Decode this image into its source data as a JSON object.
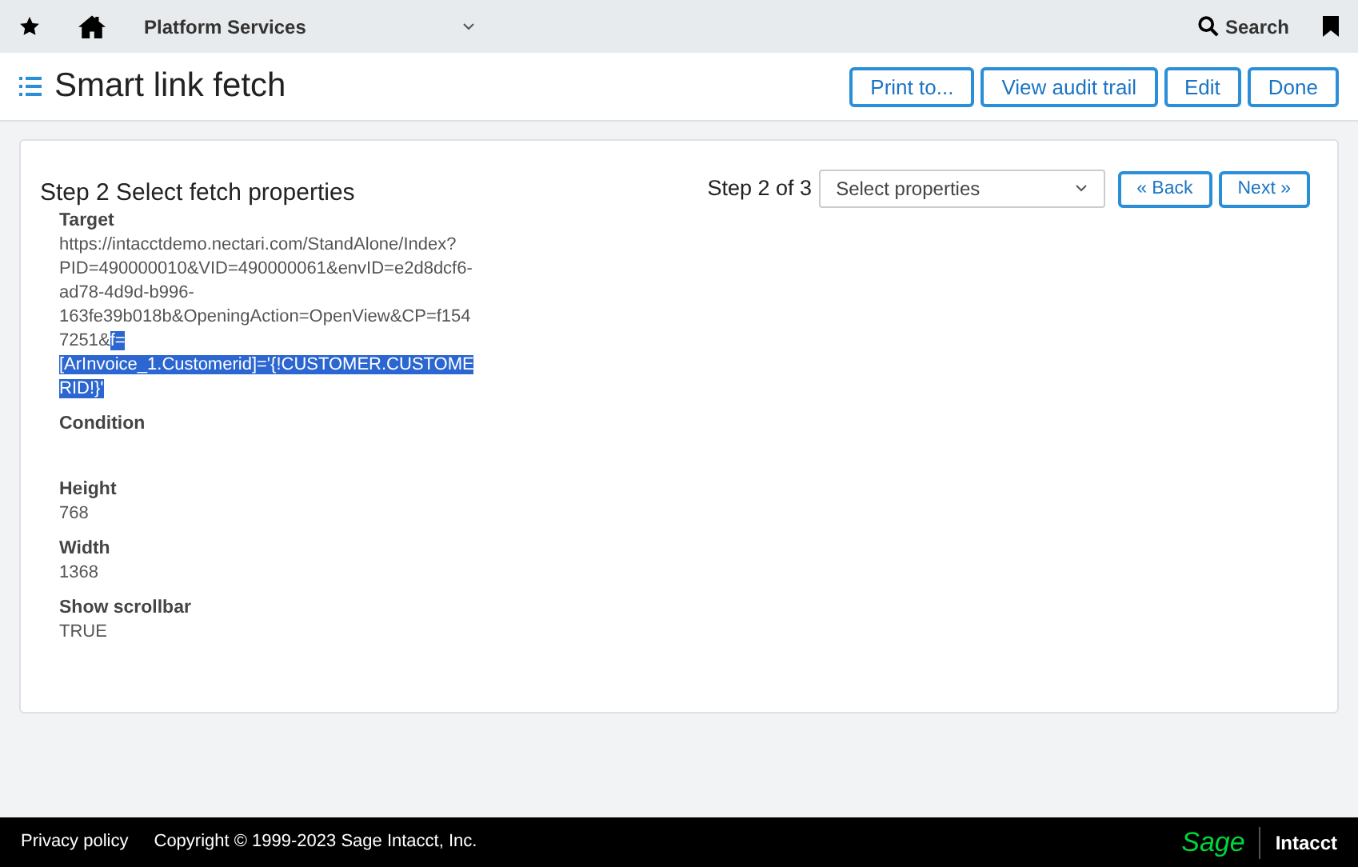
{
  "top_bar": {
    "module": "Platform Services",
    "search": "Search"
  },
  "header": {
    "title": "Smart link fetch",
    "buttons": [
      "Print to...",
      "View audit trail",
      "Edit",
      "Done"
    ]
  },
  "wizard": {
    "heading": "Step 2 Select fetch properties",
    "step": "Step 2 of 3",
    "select": {
      "value": "Select properties"
    },
    "back": "« Back",
    "next": "Next »"
  },
  "fields": [
    {
      "label": "Target",
      "value_parts": [
        {
          "text": "https://intacctdemo.nectari.com/StandAlone/Index?PID=490000010&VID=490000061&envID=e2d8dcf6-ad78-4d9d-b996-163fe39b018b&OpeningAction=OpenView&CP=f1547251&",
          "selected": false
        },
        {
          "text": "f=[ArInvoice_1.Customerid]='{!CUSTOMER.CUSTOMERID!}'",
          "selected": true
        }
      ]
    },
    {
      "label": "Condition"
    },
    {
      "label": "Height",
      "value_parts": [
        {
          "text": "768",
          "selected": false
        }
      ]
    },
    {
      "label": "Width",
      "value_parts": [
        {
          "text": "1368",
          "selected": false
        }
      ]
    },
    {
      "label": "Show scrollbar",
      "value_parts": [
        {
          "text": "TRUE",
          "selected": false
        }
      ]
    }
  ],
  "footer": {
    "links": [
      "Privacy policy"
    ],
    "copyright": "Copyright © 1999-2023 Sage Intacct, Inc.",
    "brand": "Sage",
    "product": "Intacct"
  }
}
